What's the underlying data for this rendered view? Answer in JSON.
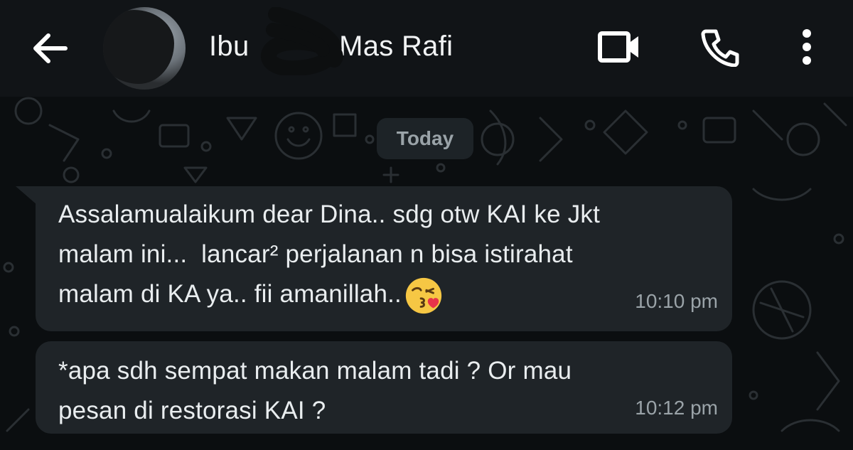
{
  "header": {
    "contact_name": "Ibu     o Mas Rafi",
    "back_icon": "arrow-left-icon",
    "video_icon": "video-camera-icon",
    "call_icon": "phone-icon",
    "menu_icon": "more-vertical-icon"
  },
  "chat": {
    "date_label": "Today",
    "messages": [
      {
        "text_line_1": "Assalamualaikum dear Dina.. sdg otw KAI ke Jkt",
        "text_line_2": "malam ini...  lancar² perjalanan n bisa istirahat",
        "text_line_3": "malam di KA ya.. fii amanillah..",
        "emoji": "face-blowing-kiss-emoji",
        "time": "10:10 pm"
      },
      {
        "text_line_1": "*apa sdh sempat makan malam tadi ? Or mau",
        "text_line_2": "pesan di restorasi KAI ?",
        "time": "10:12 pm"
      }
    ]
  },
  "colors": {
    "header_bg": "#111417",
    "chat_bg": "#0b0e10",
    "bubble_bg": "#1f2428",
    "text_primary": "#e9edef",
    "text_secondary": "#9aa3a8"
  }
}
